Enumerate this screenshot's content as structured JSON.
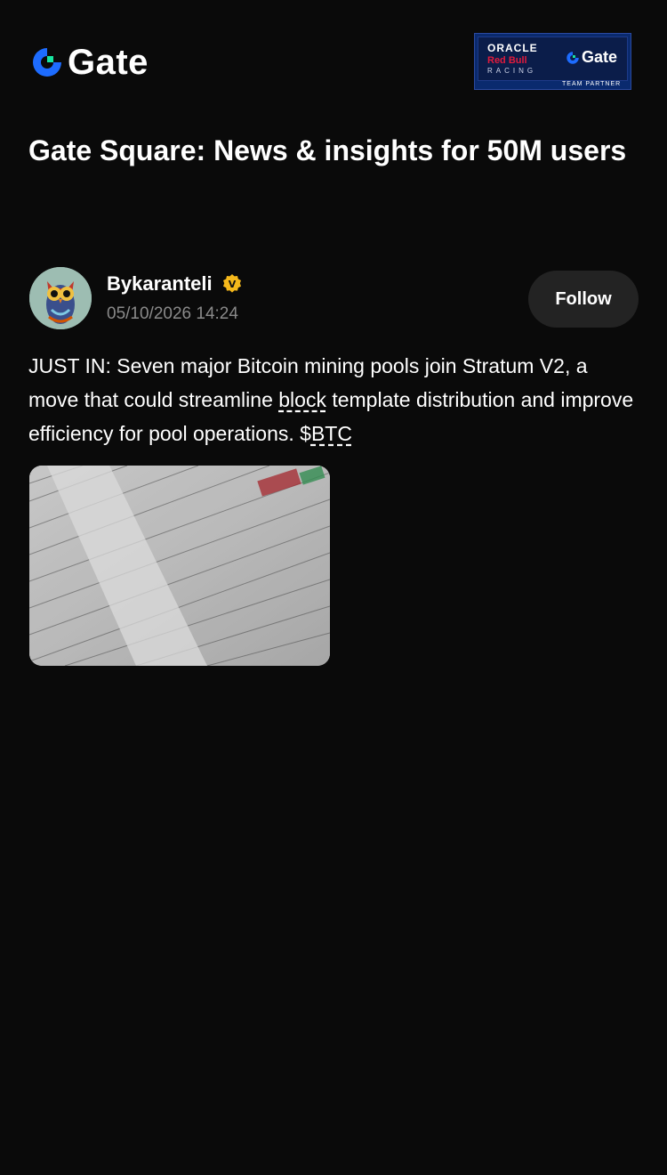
{
  "header": {
    "brand": "Gate",
    "partner": {
      "line1": "ORACLE",
      "line2": "Red Bull",
      "line3": "RACING",
      "brand": "Gate",
      "tag": "TEAM PARTNER"
    }
  },
  "page": {
    "title": "Gate Square: News & insights for 50M users"
  },
  "post": {
    "author": "Bykaranteli",
    "verified_badge": "V",
    "date": "05/10/2026 14:24",
    "follow_label": "Follow",
    "text_before": "JUST IN: Seven major Bitcoin mining pools join Stratum V2, a move that could streamline ",
    "link_block": "block",
    "text_middle": " template distribution and improve efficiency for pool operations. $",
    "link_ticker": "BTC"
  },
  "colors": {
    "background": "#0a0a0a",
    "brand_blue": "#1d6cff",
    "brand_green": "#17e6a1",
    "badge_gold": "#f5b81b",
    "muted_text": "#8a8a8a",
    "follow_bg": "#232323"
  },
  "icons": {
    "logo": "gate-logo-icon",
    "verified": "verified-badge-icon"
  }
}
